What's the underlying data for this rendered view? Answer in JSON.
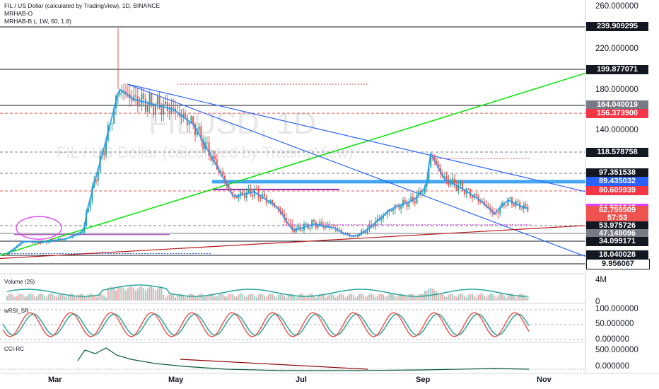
{
  "header": {
    "title": "FIL / US Dollar (calculated by TradingView), 1D, BINANCE",
    "indicator1": "MRHAB-O",
    "indicator2": "MRHAB-B (, 1W, 60, 1.8)"
  },
  "watermark": {
    "symbol": "FILUSD, 1D",
    "name": "FIL / US Dollar (calculated by TradingView)"
  },
  "colors": {
    "up": "#26a69a",
    "down": "#ef5350",
    "trend_green": "#00e600",
    "trend_blue": "#2962ff",
    "support_red": "#b71c1c",
    "ma_blue": "#2196f3",
    "highlight_magenta": "#e040fb"
  },
  "price_axis": [
    "260.000000",
    "220.000000",
    "180.000000",
    "140.000000",
    "100.000000"
  ],
  "price_tags": [
    {
      "label": "239.909295",
      "value": 239.909295,
      "bg": "#131722",
      "fg": "#ffffff"
    },
    {
      "label": "199.877071",
      "value": 199.877071,
      "bg": "#131722",
      "fg": "#ffffff"
    },
    {
      "label": "164.040019",
      "value": 164.040019,
      "bg": "#787b86",
      "fg": "#ffffff"
    },
    {
      "label": "156.373900",
      "value": 156.3739,
      "bg": "#f23645",
      "fg": "#ffffff"
    },
    {
      "label": "118.578758",
      "value": 118.578758,
      "bg": "#131722",
      "fg": "#ffffff"
    },
    {
      "label": "97.351538",
      "value": 97.351538,
      "bg": "#131722",
      "fg": "#ffffff"
    },
    {
      "label": "89.435032",
      "value": 89.435032,
      "bg": "#2962ff",
      "fg": "#ffffff"
    },
    {
      "label": "80.609939",
      "value": 80.609939,
      "bg": "#f23645",
      "fg": "#ffffff"
    },
    {
      "label": "64.531945",
      "value": 64.531945,
      "bg": "#e040fb",
      "fg": "#ffffff"
    },
    {
      "label": "62.759509",
      "value": 62.759509,
      "bg": "#ef5350",
      "fg": "#ffffff"
    },
    {
      "label": "57:53",
      "value": 58.2,
      "bg": "#ef5350",
      "fg": "#ffffff"
    },
    {
      "label": "53.975726",
      "value": 53.975726,
      "bg": "#131722",
      "fg": "#ffffff"
    },
    {
      "label": "47.149096",
      "value": 47.149096,
      "bg": "#787b86",
      "fg": "#ffffff"
    },
    {
      "label": "34.099171",
      "value": 34.099171,
      "bg": "#131722",
      "fg": "#ffffff"
    },
    {
      "label": "18.040028",
      "value": 18.040028,
      "bg": "#131722",
      "fg": "#ffffff"
    },
    {
      "label": "9.956067",
      "value": 9.956067,
      "bg": "#ffffff",
      "fg": "#131722"
    }
  ],
  "x_axis": [
    "Mar",
    "May",
    "Jul",
    "Sep",
    "Nov"
  ],
  "panes": {
    "volume": {
      "title": "Volume (26)",
      "axis": [
        "4M",
        "0"
      ]
    },
    "wrsi": {
      "title": "wRSI_SR",
      "axis": [
        "100.000000",
        "50.000000",
        "0.000000"
      ]
    },
    "cci": {
      "title": "CCI-RC",
      "axis": [
        "500.000000",
        "0.000000"
      ]
    }
  },
  "chart_data": {
    "type": "candlestick",
    "title": "FIL / US Dollar (calculated by TradingView), 1D, BINANCE",
    "ylim": [
      0,
      270
    ],
    "x_ticks": [
      "Mar",
      "May",
      "Jul",
      "Sep",
      "Nov"
    ],
    "close_path": [
      {
        "x": "Feb 1",
        "y": 18
      },
      {
        "x": "Feb 10",
        "y": 34
      },
      {
        "x": "Feb 20",
        "y": 33
      },
      {
        "x": "Mar 1",
        "y": 38
      },
      {
        "x": "Mar 10",
        "y": 50
      },
      {
        "x": "Mar 20",
        "y": 120
      },
      {
        "x": "Mar 28",
        "y": 180
      },
      {
        "x": "Apr 5",
        "y": 170
      },
      {
        "x": "Apr 15",
        "y": 165
      },
      {
        "x": "Apr 25",
        "y": 160
      },
      {
        "x": "May 5",
        "y": 145
      },
      {
        "x": "May 15",
        "y": 110
      },
      {
        "x": "May 25",
        "y": 75
      },
      {
        "x": "Jun 5",
        "y": 80
      },
      {
        "x": "Jun 15",
        "y": 68
      },
      {
        "x": "Jun 25",
        "y": 50
      },
      {
        "x": "Jul 5",
        "y": 55
      },
      {
        "x": "Jul 15",
        "y": 52
      },
      {
        "x": "Jul 25",
        "y": 42
      },
      {
        "x": "Aug 5",
        "y": 55
      },
      {
        "x": "Aug 15",
        "y": 65
      },
      {
        "x": "Aug 25",
        "y": 72
      },
      {
        "x": "Sep 1",
        "y": 85
      },
      {
        "x": "Sep 3",
        "y": 118
      },
      {
        "x": "Sep 10",
        "y": 92
      },
      {
        "x": "Sep 20",
        "y": 82
      },
      {
        "x": "Sep 28",
        "y": 72
      },
      {
        "x": "Oct 5",
        "y": 60
      },
      {
        "x": "Oct 12",
        "y": 72
      },
      {
        "x": "Oct 20",
        "y": 65
      },
      {
        "x": "Oct 26",
        "y": 63
      }
    ],
    "levels": [
      239.909295,
      199.877071,
      164.040019,
      156.3739,
      118.578758,
      97.351538,
      89.435032,
      80.609939,
      64.531945,
      62.759509,
      53.975726,
      47.149096,
      34.099171,
      18.040028,
      9.956067
    ],
    "last_price": 62.759509
  }
}
